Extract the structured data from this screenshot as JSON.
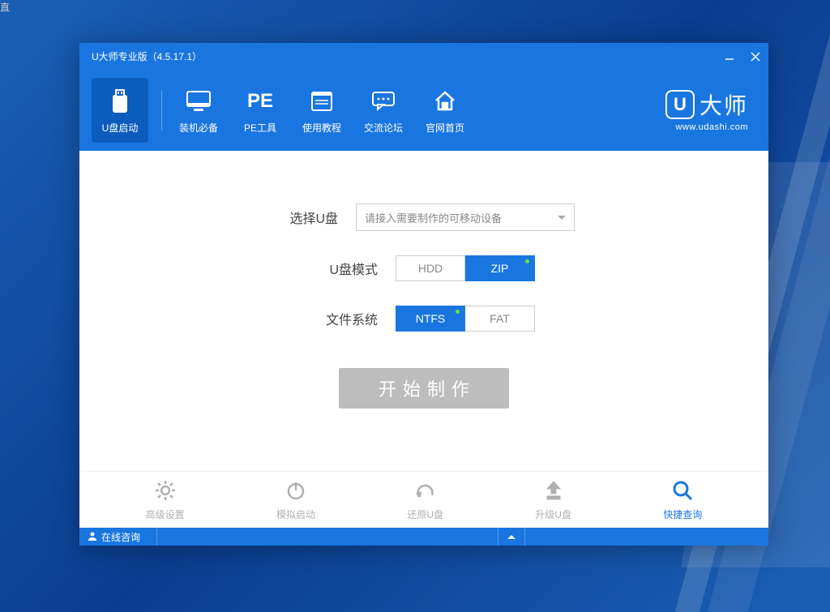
{
  "window": {
    "title": "U大师专业版（4.5.17.1）"
  },
  "nav": {
    "items": [
      {
        "label": "U盘启动"
      },
      {
        "label": "装机必备"
      },
      {
        "label": "PE工具",
        "pe_text": "PE"
      },
      {
        "label": "使用教程"
      },
      {
        "label": "交流论坛"
      },
      {
        "label": "官网首页"
      }
    ]
  },
  "logo": {
    "brand": "大师",
    "url": "www.udashi.com"
  },
  "form": {
    "select_label": "选择U盘",
    "select_placeholder": "请接入需要制作的可移动设备",
    "mode_label": "U盘模式",
    "mode_options": {
      "hdd": "HDD",
      "zip": "ZIP"
    },
    "fs_label": "文件系统",
    "fs_options": {
      "ntfs": "NTFS",
      "fat": "FAT"
    },
    "start_label": "开始制作"
  },
  "bottom": {
    "items": [
      {
        "label": "高级设置"
      },
      {
        "label": "模拟启动"
      },
      {
        "label": "还原U盘"
      },
      {
        "label": "升级U盘"
      },
      {
        "label": "快捷查询"
      }
    ]
  },
  "status": {
    "consult": "在线咨询"
  }
}
